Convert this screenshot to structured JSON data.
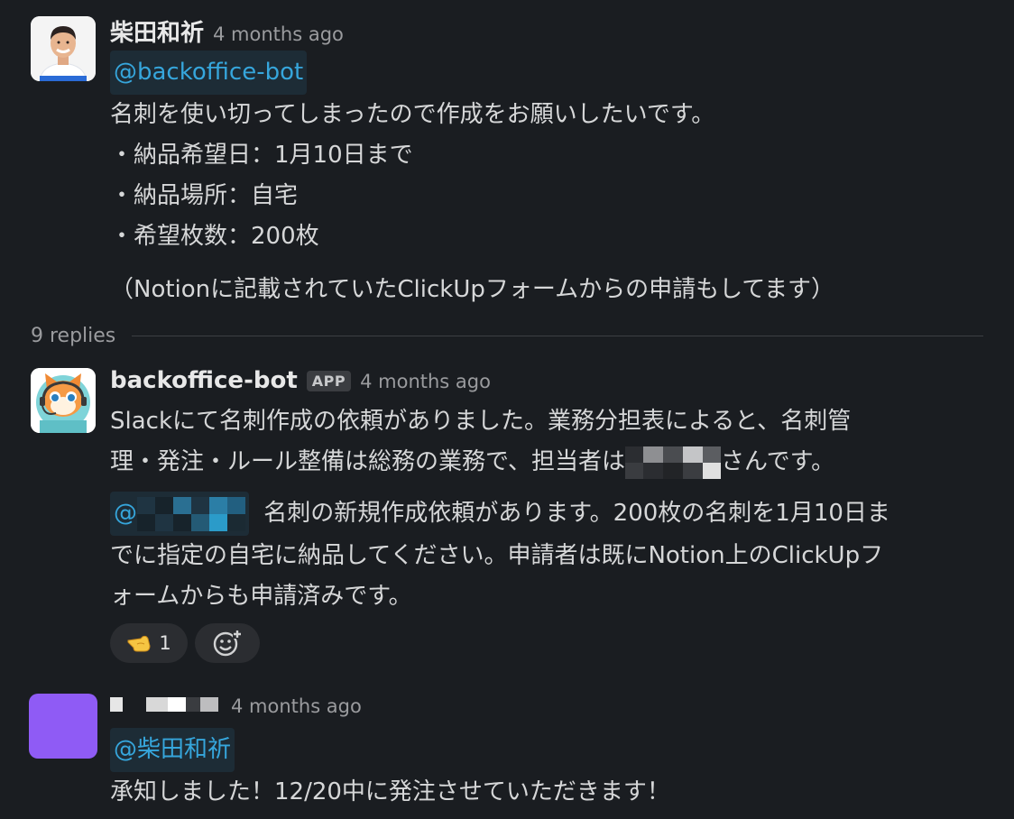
{
  "messages": [
    {
      "author": "柴田和祈",
      "timestamp": "4 months ago",
      "mention": "@backoffice-bot",
      "lines": [
        "名刺を使い切ってしまったので作成をお願いしたいです。",
        "・納品希望日：1月10日まで",
        "・納品場所：自宅",
        "・希望枚数：200枚",
        "（Notionに記載されていたClickUpフォームからの申請もしてます）"
      ]
    },
    {
      "author": "backoffice-bot",
      "badge": "APP",
      "timestamp": "4 months ago",
      "para1_line1": "Slackにて名刺作成の依頼がありました。業務分担表によると、名刺管",
      "para1_line2_a": "理・発注・ルール整備は総務の業務で、担当者は",
      "para1_line2_b": "さんです。",
      "mention_prefix": "@",
      "para2_line1": "名刺の新規作成依頼があります。200枚の名刺を1月10日ま",
      "para2_line2": "でに指定の自宅に納品してください。申請者は既にNotion上のClickUpフ",
      "para2_line3": "ォームからも申請済みです。",
      "reaction_count": "1",
      "reaction_icon": "pointing-hand-emoji",
      "add_reaction_icon": "add-reaction-icon"
    },
    {
      "timestamp": "4 months ago",
      "mention": "@柴田和祈",
      "text": "承知しました！12/20中に発注させていただきます！"
    }
  ],
  "thread": {
    "replies_label": "9 replies"
  },
  "colors": {
    "background": "#1a1d21",
    "mention": "#36a6dc",
    "avatar_purple": "#8f5bf5"
  }
}
